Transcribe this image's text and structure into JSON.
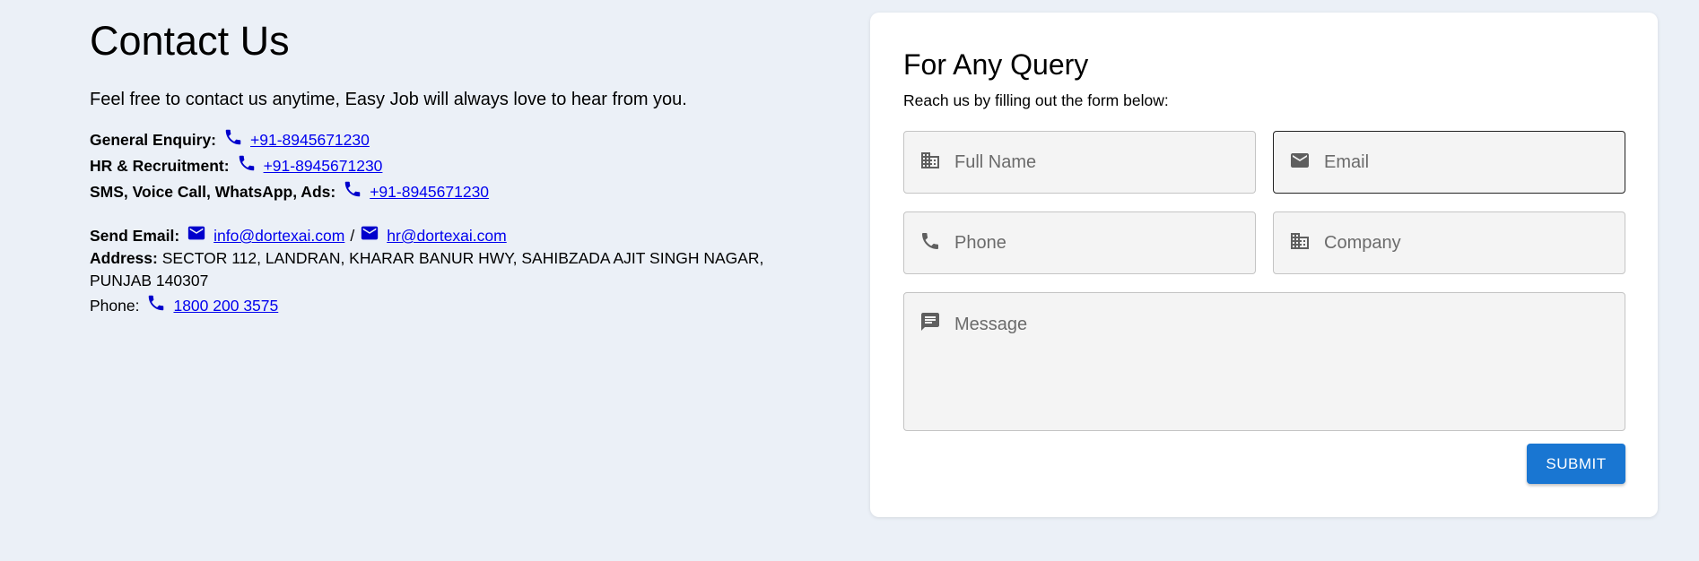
{
  "contact": {
    "title": "Contact Us",
    "intro": "Feel free to contact us anytime, Easy Job will always love to hear from you.",
    "rows": [
      {
        "label": "General Enquiry:",
        "icon": "phone-icon",
        "value": "+91-8945671230"
      },
      {
        "label": "HR & Recruitment:",
        "icon": "phone-icon",
        "value": "+91-8945671230"
      },
      {
        "label": "SMS, Voice Call, WhatsApp, Ads:",
        "icon": "phone-icon",
        "value": "+91-8945671230"
      }
    ],
    "email": {
      "label": "Send Email:",
      "primary": "info@dortexai.com",
      "separator": "/",
      "secondary": "hr@dortexai.com"
    },
    "address": {
      "label": "Address:",
      "value": "SECTOR 112, LANDRAN, KHARAR BANUR HWY, SAHIBZADA AJIT SINGH NAGAR,",
      "value_line2": "PUNJAB 140307"
    },
    "phone": {
      "label": "Phone:",
      "value": "1800 200 3575"
    }
  },
  "form": {
    "title": "For Any Query",
    "subtitle": "Reach us by filling out the form below:",
    "fields": {
      "full_name": {
        "placeholder": "Full Name",
        "icon": "business-icon"
      },
      "email": {
        "placeholder": "Email",
        "icon": "mail-icon"
      },
      "phone": {
        "placeholder": "Phone",
        "icon": "phone-icon"
      },
      "company": {
        "placeholder": "Company",
        "icon": "business-icon"
      },
      "message": {
        "placeholder": "Message",
        "icon": "message-icon"
      }
    },
    "submit_label": "SUBMIT"
  },
  "colors": {
    "page_bg": "#ebf0f7",
    "card_bg": "#ffffff",
    "link": "#0000ee",
    "accent": "#1976d2"
  }
}
